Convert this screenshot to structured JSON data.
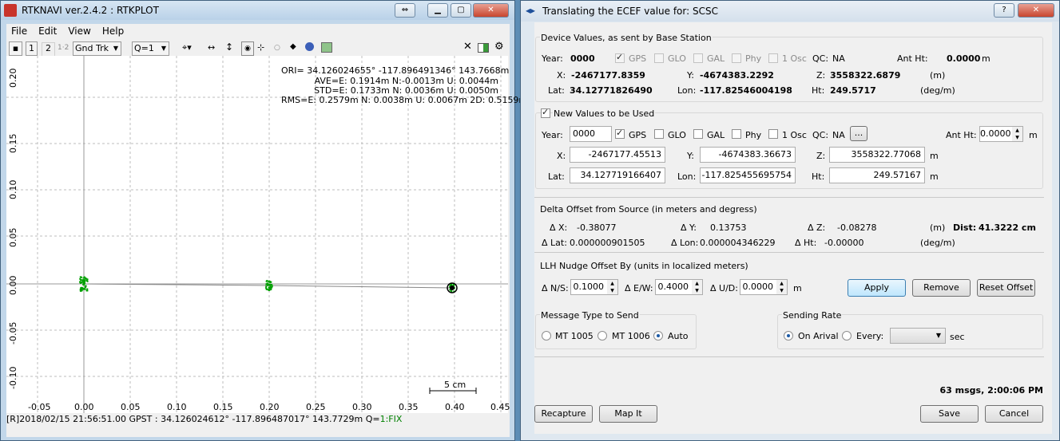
{
  "left_window": {
    "title": "RTKNAVI ver.2.4.2 : RTKPLOT",
    "menu": [
      "File",
      "Edit",
      "View",
      "Help"
    ],
    "toolbar": {
      "btn1": "1",
      "btn2": "2",
      "btn12": "1·2",
      "plot_type": "Gnd Trk",
      "quality": "Q=1"
    },
    "info": {
      "ori": "ORI= 34.126024655° -117.896491346° 143.7668m",
      "ave": "AVE=E: 0.1914m N:-0.0013m U: 0.0044m",
      "std": "STD=E: 0.1733m N: 0.0036m U: 0.0050m",
      "rms": "RMS=E: 0.2579m N: 0.0038m U: 0.0067m 2D: 0.5159m"
    },
    "x_ticks": [
      "-0.05",
      "0.00",
      "0.05",
      "0.10",
      "0.15",
      "0.20",
      "0.25",
      "0.30",
      "0.35",
      "0.40",
      "0.45"
    ],
    "y_ticks": [
      "0.20",
      "0.15",
      "0.10",
      "0.05",
      "0.00",
      "-0.05",
      "-0.10"
    ],
    "scale_label": "5 cm",
    "status": "[R]2018/02/15 21:56:51.00 GPST :  34.126024612° -117.896487017°  143.7729m  Q=",
    "fix": "1:FIX",
    "fix_color": "#008000",
    "point_color": "#00a000"
  },
  "right_window": {
    "title": "Translating the ECEF value for: SCSC",
    "device": {
      "legend": "Device Values, as sent by Base Station",
      "year_label": "Year:",
      "year": "0000",
      "gps": "GPS",
      "glo": "GLO",
      "gal": "GAL",
      "phy": "Phy",
      "osc": "1 Osc",
      "qc_label": "QC:",
      "qc": "NA",
      "ant_label": "Ant Ht:",
      "ant": "0.0000",
      "ant_unit": "m",
      "x_label": "X:",
      "x": "-2467177.8359",
      "y_label": "Y:",
      "y": "-4674383.2292",
      "z_label": "Z:",
      "z": "3558322.6879",
      "xyz_unit": "(m)",
      "lat_label": "Lat:",
      "lat": "34.12771826490",
      "lon_label": "Lon:",
      "lon": "-117.82546004198",
      "ht_label": "Ht:",
      "ht": "249.5717",
      "llh_unit": "(deg/m)"
    },
    "new": {
      "legend": "New Values to be Used",
      "year_label": "Year:",
      "year": "0000",
      "gps": "GPS",
      "glo": "GLO",
      "gal": "GAL",
      "phy": "Phy",
      "osc": "1 Osc",
      "qc_label": "QC:",
      "qc": "NA",
      "more": "...",
      "ant_label": "Ant Ht:",
      "ant": "0.0000",
      "ant_unit": "m",
      "x_label": "X:",
      "x": "-2467177.45513",
      "y_label": "Y:",
      "y": "-4674383.36673",
      "z_label": "Z:",
      "z": "3558322.77068",
      "m": "m",
      "lat_label": "Lat:",
      "lat": "34.127719166407",
      "lon_label": "Lon:",
      "lon": "-117.825455695754",
      "ht_label": "Ht:",
      "ht": "249.57167"
    },
    "delta": {
      "legend": "Delta Offset from Source (in meters and degress)",
      "dx_label": "Δ X:",
      "dx": "-0.38077",
      "dy_label": "Δ Y:",
      "dy": "0.13753",
      "dz_label": "Δ Z:",
      "dz": "-0.08278",
      "xyz_unit": "(m)",
      "dist_label": "Dist:",
      "dist": "41.3222 cm",
      "dlat_label": "Δ Lat:",
      "dlat": "0.000000901505",
      "dlon_label": "Δ Lon:",
      "dlon": "0.000004346229",
      "dht_label": "Δ Ht:",
      "dht": "-0.00000",
      "llh_unit": "(deg/m)"
    },
    "nudge": {
      "legend": "LLH Nudge Offset By   (units in localized meters)",
      "ns_label": "Δ N/S:",
      "ns": "0.1000",
      "ew_label": "Δ E/W:",
      "ew": "0.4000",
      "ud_label": "Δ U/D:",
      "ud": "0.0000",
      "unit": "m",
      "apply": "Apply",
      "remove": "Remove",
      "reset": "Reset Offset"
    },
    "msgtype": {
      "legend": "Message Type to Send",
      "mt1005": "MT 1005",
      "mt1006": "MT 1006",
      "auto": "Auto"
    },
    "rate": {
      "legend": "Sending Rate",
      "arrival": "On Arival",
      "every": "Every:",
      "sec": "sec"
    },
    "msgs": "63 msgs,  2:00:06 PM",
    "buttons": {
      "recapture": "Recapture",
      "map": "Map It",
      "save": "Save",
      "cancel": "Cancel"
    }
  }
}
